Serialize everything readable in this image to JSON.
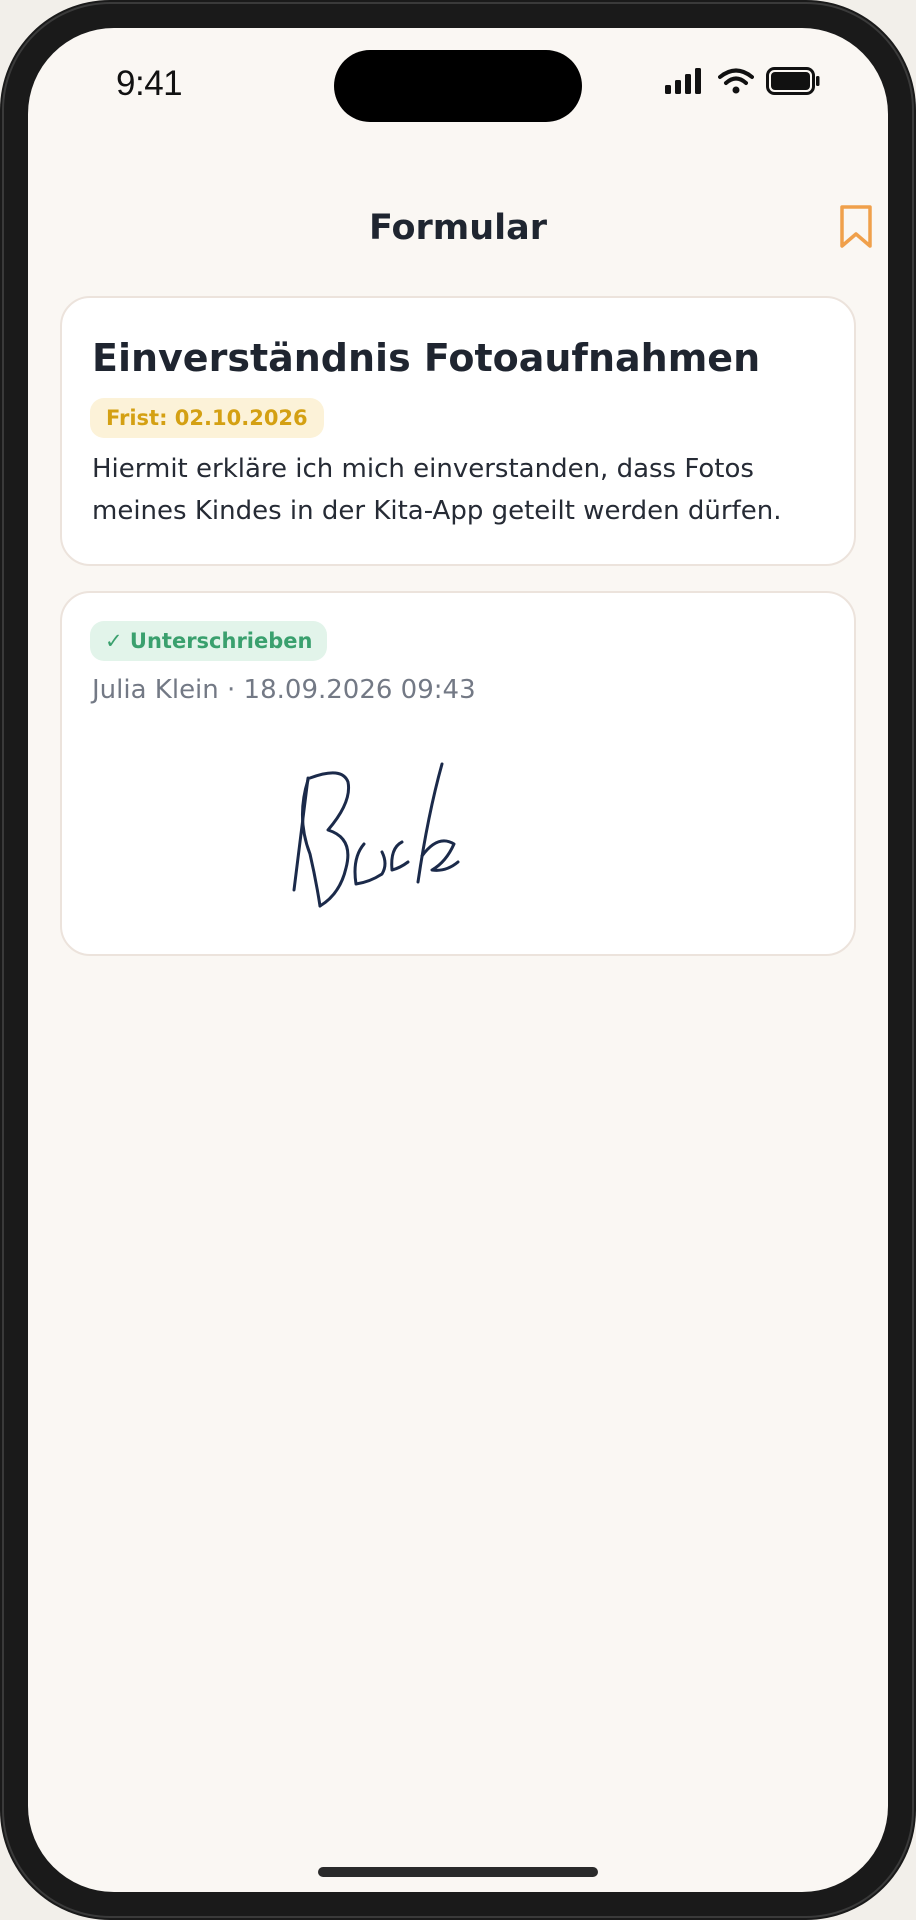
{
  "status_bar": {
    "time": "9:41",
    "icons": [
      "signal-icon",
      "wifi-icon",
      "battery-icon"
    ]
  },
  "nav": {
    "title": "Formular",
    "bookmark_icon": "bookmark-icon",
    "accent_color": "#f0a04b"
  },
  "form": {
    "title": "Einverständnis Fotoaufnahmen",
    "deadline": "Frist: 02.10.2026",
    "description": "Hiermit erkläre ich mich einverstanden, dass Fotos meines Kindes in der Kita-App geteilt werden dürfen."
  },
  "signature": {
    "status": "✓ Unterschrieben",
    "meta": "Julia Klein · 18.09.2026 09:43",
    "stroke_color": "#1b2a4a"
  },
  "colors": {
    "background": "#faf7f3",
    "deadline_text": "#d4a013",
    "deadline_bg": "#fcf2d8",
    "signed_text": "#3aa06e",
    "signed_bg": "#e2f4ea"
  }
}
